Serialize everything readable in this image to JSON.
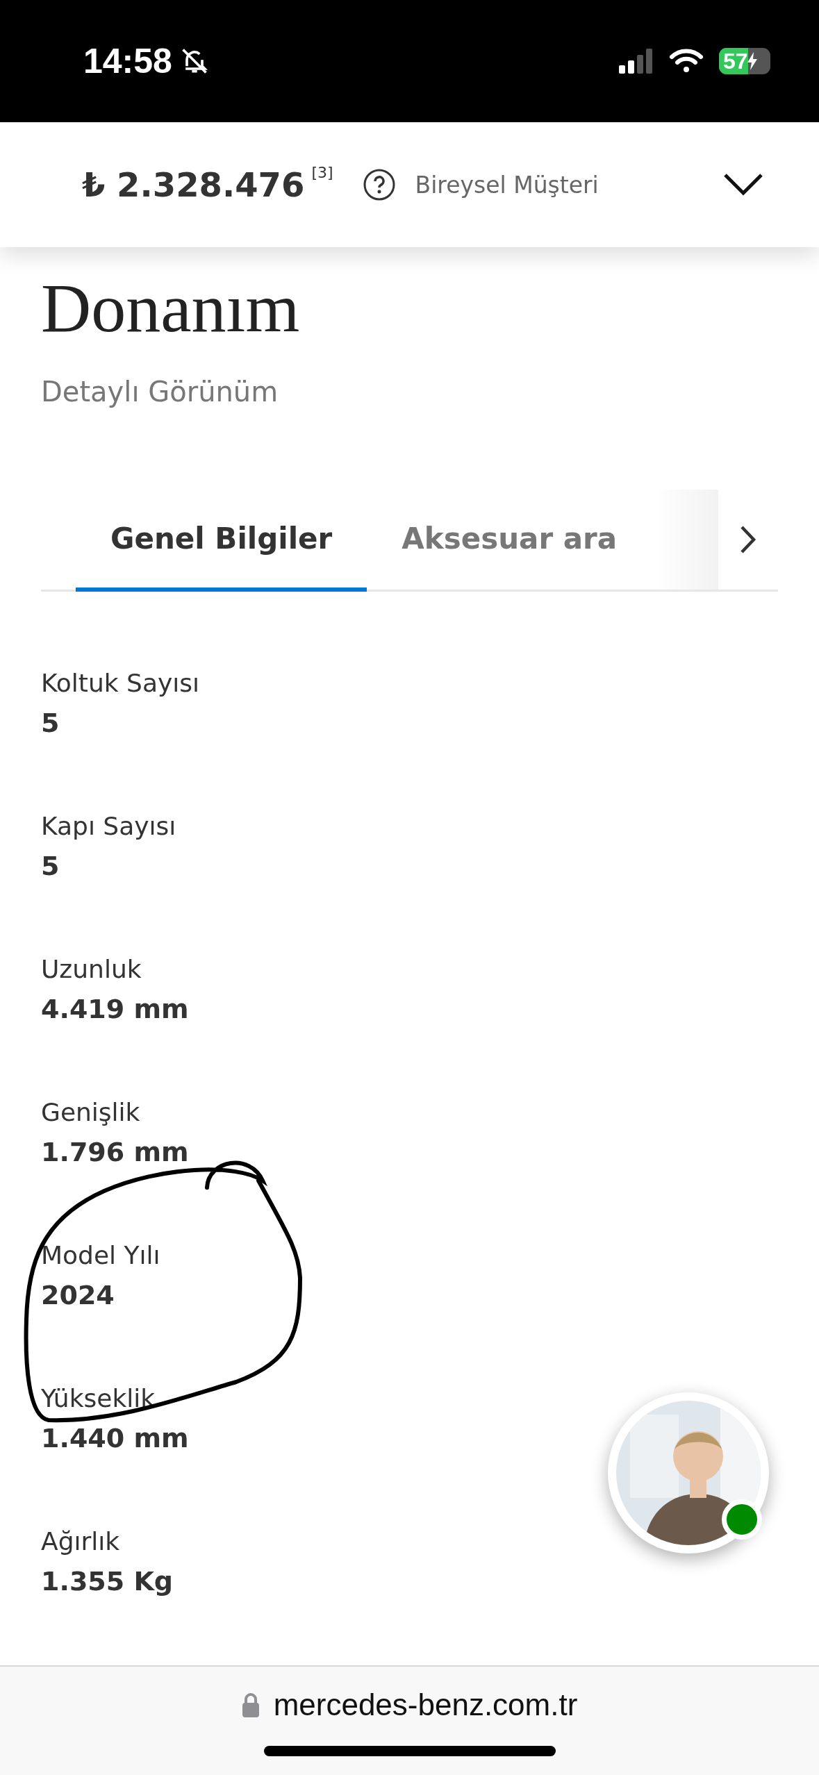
{
  "status_bar": {
    "time": "14:58",
    "silent": true,
    "battery": "57",
    "charging": true
  },
  "price_bar": {
    "price": "₺ 2.328.476",
    "footnote": "[3]",
    "customer_type": "Bireysel Müşteri",
    "expanded": false
  },
  "page": {
    "title": "Donanım",
    "subtitle": "Detaylı Görünüm"
  },
  "tabs": [
    {
      "label": "Genel Bilgiler",
      "selected": true
    },
    {
      "label": "Aksesuar ara",
      "selected": false
    }
  ],
  "specs": [
    {
      "label": "Koltuk Sayısı",
      "value": "5"
    },
    {
      "label": "Kapı Sayısı",
      "value": "5"
    },
    {
      "label": "Uzunluk",
      "value": "4.419 mm"
    },
    {
      "label": "Genişlik",
      "value": "1.796 mm"
    },
    {
      "label": "Model Yılı",
      "value": "2024"
    },
    {
      "label": "Yükseklik",
      "value": "1.440 mm"
    },
    {
      "label": "Ağırlık",
      "value": "1.355 Kg"
    }
  ],
  "chat_avatar": {
    "online": true
  },
  "browser_bar": {
    "url": "mercedes-benz.com.tr",
    "secure": true
  }
}
